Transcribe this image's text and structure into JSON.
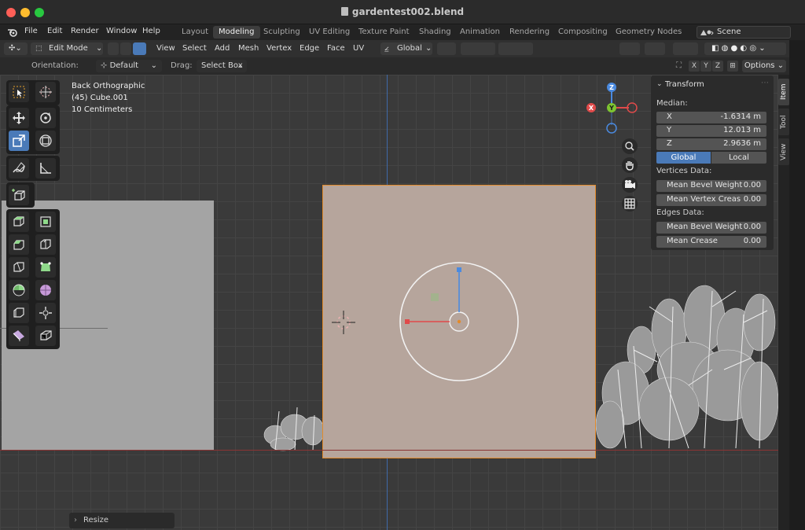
{
  "window": {
    "title": "gardentest002.blend"
  },
  "menu": {
    "items": [
      "File",
      "Edit",
      "Render",
      "Window",
      "Help"
    ],
    "workspaces": [
      "Layout",
      "Modeling",
      "Sculpting",
      "UV Editing",
      "Texture Paint",
      "Shading",
      "Animation",
      "Rendering",
      "Compositing",
      "Geometry Nodes"
    ],
    "active_workspace": "Modeling",
    "scene": "Scene"
  },
  "header": {
    "mode": "Edit Mode",
    "menus": [
      "View",
      "Select",
      "Add",
      "Mesh",
      "Vertex",
      "Edge",
      "Face",
      "UV"
    ],
    "transform_orientation": "Global"
  },
  "tool_settings": {
    "orientation_label": "Orientation:",
    "orientation_value": "Default",
    "drag_label": "Drag:",
    "drag_value": "Select Box",
    "axes": [
      "X",
      "Y",
      "Z"
    ],
    "options_label": "Options"
  },
  "viewport": {
    "view_name": "Back Orthographic",
    "object_name": "(45) Cube.001",
    "scale": "10 Centimeters",
    "gizmo_axes": [
      "Z",
      "Y",
      "X"
    ]
  },
  "transform_panel": {
    "title": "Transform",
    "median_label": "Median:",
    "fields": [
      {
        "axis": "X",
        "value": "-1.6314 m"
      },
      {
        "axis": "Y",
        "value": "12.013 m"
      },
      {
        "axis": "Z",
        "value": "2.9636 m"
      }
    ],
    "space": [
      "Global",
      "Local"
    ],
    "vertices_label": "Vertices Data:",
    "vertices": [
      {
        "label": "Mean Bevel Weight",
        "value": "0.00"
      },
      {
        "label": "Mean Vertex Creas",
        "value": "0.00"
      }
    ],
    "edges_label": "Edges Data:",
    "edges": [
      {
        "label": "Mean Bevel Weight",
        "value": "0.00"
      },
      {
        "label": "Mean Crease",
        "value": "0.00"
      }
    ]
  },
  "sidebar_tabs": [
    "Item",
    "Tool",
    "View"
  ],
  "operator_panel": {
    "label": "Resize"
  },
  "colors": {
    "accent": "#4a7ab8",
    "selection": "#e38a2a",
    "axis_x": "#e04a4a",
    "axis_y": "#7ec531",
    "axis_z": "#4a8ae0"
  }
}
